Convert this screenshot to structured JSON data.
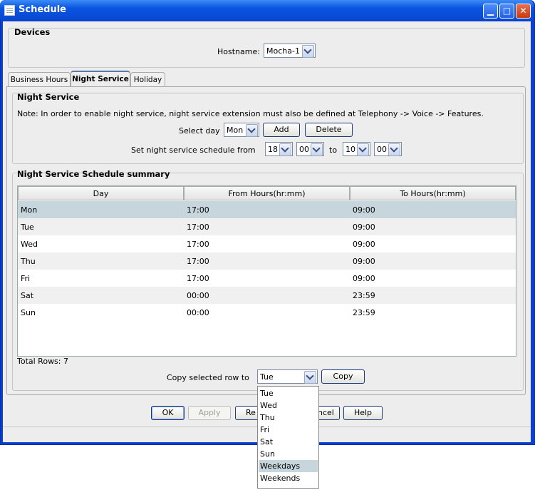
{
  "window": {
    "title": "Schedule",
    "controls": [
      "minimize-icon",
      "maximize-icon",
      "close-icon"
    ]
  },
  "devices": {
    "heading": "Devices",
    "hostname_label": "Hostname:",
    "hostname_value": "Mocha-1"
  },
  "tabs": [
    {
      "label": "Business Hours",
      "active": false
    },
    {
      "label": "Night Service",
      "active": true
    },
    {
      "label": "Holiday",
      "active": false
    }
  ],
  "night_service": {
    "heading": "Night Service",
    "note": "Note: In order to enable night service, night service extension must also be defined at Telephony -> Voice -> Features.",
    "select_day_label": "Select day",
    "select_day_value": "Mon",
    "add_label": "Add",
    "delete_label": "Delete",
    "schedule_from_label": "Set night service schedule from",
    "from_hour": "18",
    "from_minute": "00",
    "to_label": "to",
    "to_hour": "10",
    "to_minute": "00"
  },
  "summary": {
    "heading": "Night Service Schedule summary",
    "columns": [
      "Day",
      "From Hours(hr:mm)",
      "To Hours(hr:mm)"
    ],
    "rows": [
      [
        "Mon",
        "17:00",
        "09:00"
      ],
      [
        "Tue",
        "17:00",
        "09:00"
      ],
      [
        "Wed",
        "17:00",
        "09:00"
      ],
      [
        "Thu",
        "17:00",
        "09:00"
      ],
      [
        "Fri",
        "17:00",
        "09:00"
      ],
      [
        "Sat",
        "00:00",
        "23:59"
      ],
      [
        "Sun",
        "00:00",
        "23:59"
      ]
    ],
    "selected_row": 0,
    "total_rows_text": "Total Rows: 7"
  },
  "copy": {
    "label": "Copy selected row to",
    "value": "Tue",
    "button_label": "Copy",
    "options": [
      "Tue",
      "Wed",
      "Thu",
      "Fri",
      "Sat",
      "Sun",
      "Weekdays",
      "Weekends"
    ],
    "highlighted_option": "Weekdays"
  },
  "footer": {
    "ok_label": "OK",
    "apply_label": "Apply",
    "reset_label": "Re",
    "cancel_label": "ncel",
    "help_label": "Help"
  },
  "colors": {
    "title_bar": "#0a55e3",
    "row_selected": "#c6d6dc",
    "row_alt": "#f0f0f0"
  }
}
